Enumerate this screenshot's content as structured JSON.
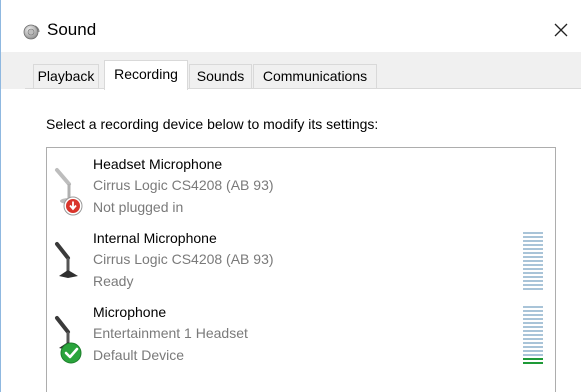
{
  "window": {
    "title": "Sound",
    "app_icon": "speaker-icon",
    "close_glyph": "✕"
  },
  "tabs": [
    {
      "label": "Playback",
      "active": false
    },
    {
      "label": "Recording",
      "active": true
    },
    {
      "label": "Sounds",
      "active": false
    },
    {
      "label": "Communications",
      "active": false
    }
  ],
  "content": {
    "instruction": "Select a recording device below to modify its settings:"
  },
  "devices": [
    {
      "name": "Headset Microphone",
      "description": "Cirrus Logic CS4208 (AB 93)",
      "status": "Not plugged in",
      "status_icon": "unplugged-down-arrow-icon",
      "level_meter_visible": false
    },
    {
      "name": "Internal Microphone",
      "description": "Cirrus Logic CS4208 (AB 93)",
      "status": "Ready",
      "status_icon": "",
      "level_meter_visible": true,
      "level_fraction": 0
    },
    {
      "name": "Microphone",
      "description": "Entertainment 1 Headset",
      "status": "Default Device",
      "status_icon": "default-checkmark-icon",
      "level_meter_visible": true,
      "level_fraction": 0.15
    }
  ],
  "colors": {
    "accent_border": "#8fb8e0",
    "tab_background": "#f0f0f0",
    "secondary_text": "#7a7a7a",
    "meter_off": "#a9c4d8",
    "meter_on": "#1e9a38",
    "default_check": "#2aa43c",
    "unplugged_badge": "#d9342b"
  }
}
